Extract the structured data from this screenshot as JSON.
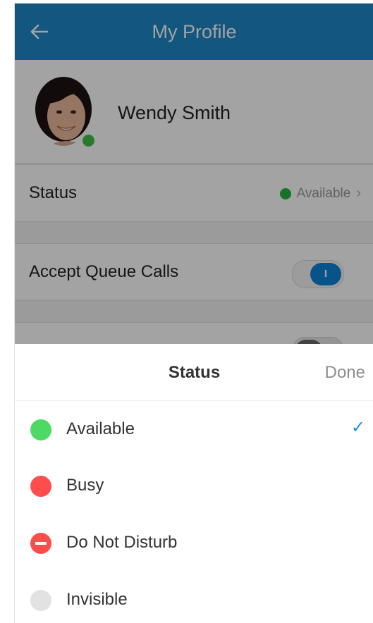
{
  "header": {
    "title": "My Profile"
  },
  "profile": {
    "name": "Wendy Smith"
  },
  "status_row": {
    "label": "Status",
    "value": "Available"
  },
  "queue_row": {
    "label": "Accept Queue Calls",
    "toggle_text": "I",
    "toggle_on": true
  },
  "sheet": {
    "title": "Status",
    "done_label": "Done",
    "options": [
      {
        "label": "Available",
        "color": "#4cd964",
        "selected": true
      },
      {
        "label": "Busy",
        "color": "#ff4d4d",
        "selected": false
      },
      {
        "label": "Do Not Disturb",
        "color": "#ff4d4d",
        "selected": false
      },
      {
        "label": "Invisible",
        "color": "#e2e2e2",
        "selected": false
      }
    ],
    "check_symbol": "✓"
  },
  "colors": {
    "header_bg": "#1e87c9",
    "accent_blue": "#2b8ad9",
    "presence_green": "#3fbf4a"
  }
}
